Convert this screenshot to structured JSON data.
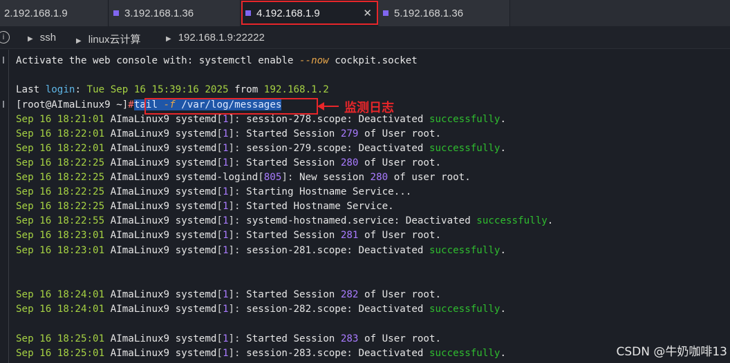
{
  "tabs": [
    {
      "label": "2.192.168.1.9"
    },
    {
      "label": "3.192.168.1.36"
    },
    {
      "label": "4.192.168.1.9"
    },
    {
      "label": "5.192.168.1.36"
    }
  ],
  "breadcrumb": {
    "items": [
      "ssh",
      "linux云计算",
      "192.168.1.9:22222"
    ]
  },
  "terminal": {
    "activate": {
      "pre": "Activate the web console with: systemctl enable ",
      "flag": "--now",
      "post": " cockpit.socket"
    },
    "last_login": {
      "pre": "Last ",
      "login": "login",
      "colon": ":",
      "date": " Tue Sep 16 15:39:16 2025 ",
      "from": "from",
      "ip": " 192.168.1.2"
    },
    "prompt": "[root@AImaLinux9 ~]",
    "hash": "#",
    "cmd": {
      "a": "tail ",
      "b": "-f",
      "c": " /var/log/messages"
    },
    "annotation": "监测日志",
    "log": [
      {
        "d": "Sep 16 18:21:01",
        "p": " AImaLinux9 systemd",
        "pid": "1",
        "msg": "session-278.scope",
        "sep": ": Deactivated ",
        "ok": "successfully",
        "end": "."
      },
      {
        "d": "Sep 16 18:22:01",
        "p": " AImaLinux9 systemd",
        "pid": "1",
        "msg": "Started Session ",
        "num": "279",
        "tail": " of User root."
      },
      {
        "d": "Sep 16 18:22:01",
        "p": " AImaLinux9 systemd",
        "pid": "1",
        "msg": "session-279.scope",
        "sep": ": Deactivated ",
        "ok": "successfully",
        "end": "."
      },
      {
        "d": "Sep 16 18:22:25",
        "p": " AImaLinux9 systemd",
        "pid": "1",
        "msg": "Started Session ",
        "num": "280",
        "tail": " of User root."
      },
      {
        "d": "Sep 16 18:22:25",
        "p": " AImaLinux9 systemd-logind",
        "pid": "805",
        "msg": "New session ",
        "num": "280",
        "tail": " of user root."
      },
      {
        "d": "Sep 16 18:22:25",
        "p": " AImaLinux9 systemd",
        "pid": "1",
        "msg": "Starting Hostname Service..."
      },
      {
        "d": "Sep 16 18:22:25",
        "p": " AImaLinux9 systemd",
        "pid": "1",
        "msg": "Started Hostname Service."
      },
      {
        "d": "Sep 16 18:22:55",
        "p": " AImaLinux9 systemd",
        "pid": "1",
        "msg": "systemd-hostnamed.service",
        "sep": ": Deactivated ",
        "ok": "successfully",
        "end": "."
      },
      {
        "d": "Sep 16 18:23:01",
        "p": " AImaLinux9 systemd",
        "pid": "1",
        "msg": "Started Session ",
        "num": "281",
        "tail": " of User root."
      },
      {
        "d": "Sep 16 18:23:01",
        "p": " AImaLinux9 systemd",
        "pid": "1",
        "msg": "session-281.scope",
        "sep": ": Deactivated ",
        "ok": "successfully",
        "end": "."
      },
      {
        "d": "Sep 16 18:24:01",
        "p": " AImaLinux9 systemd",
        "pid": "1",
        "msg": "Started Session ",
        "num": "282",
        "tail": " of User root."
      },
      {
        "d": "Sep 16 18:24:01",
        "p": " AImaLinux9 systemd",
        "pid": "1",
        "msg": "session-282.scope",
        "sep": ": Deactivated ",
        "ok": "successfully",
        "end": "."
      },
      {
        "d": "Sep 16 18:25:01",
        "p": " AImaLinux9 systemd",
        "pid": "1",
        "msg": "Started Session ",
        "num": "283",
        "tail": " of User root."
      },
      {
        "d": "Sep 16 18:25:01",
        "p": " AImaLinux9 systemd",
        "pid": "1",
        "msg": "session-283.scope",
        "sep": ": Deactivated ",
        "ok": "successfully",
        "end": "."
      }
    ]
  },
  "watermark": "CSDN @牛奶咖啡13",
  "colors": {
    "accent_tab": "#8066f0",
    "highlight": "#e8262a",
    "success": "#2fbd2f",
    "date": "#a6d243"
  }
}
